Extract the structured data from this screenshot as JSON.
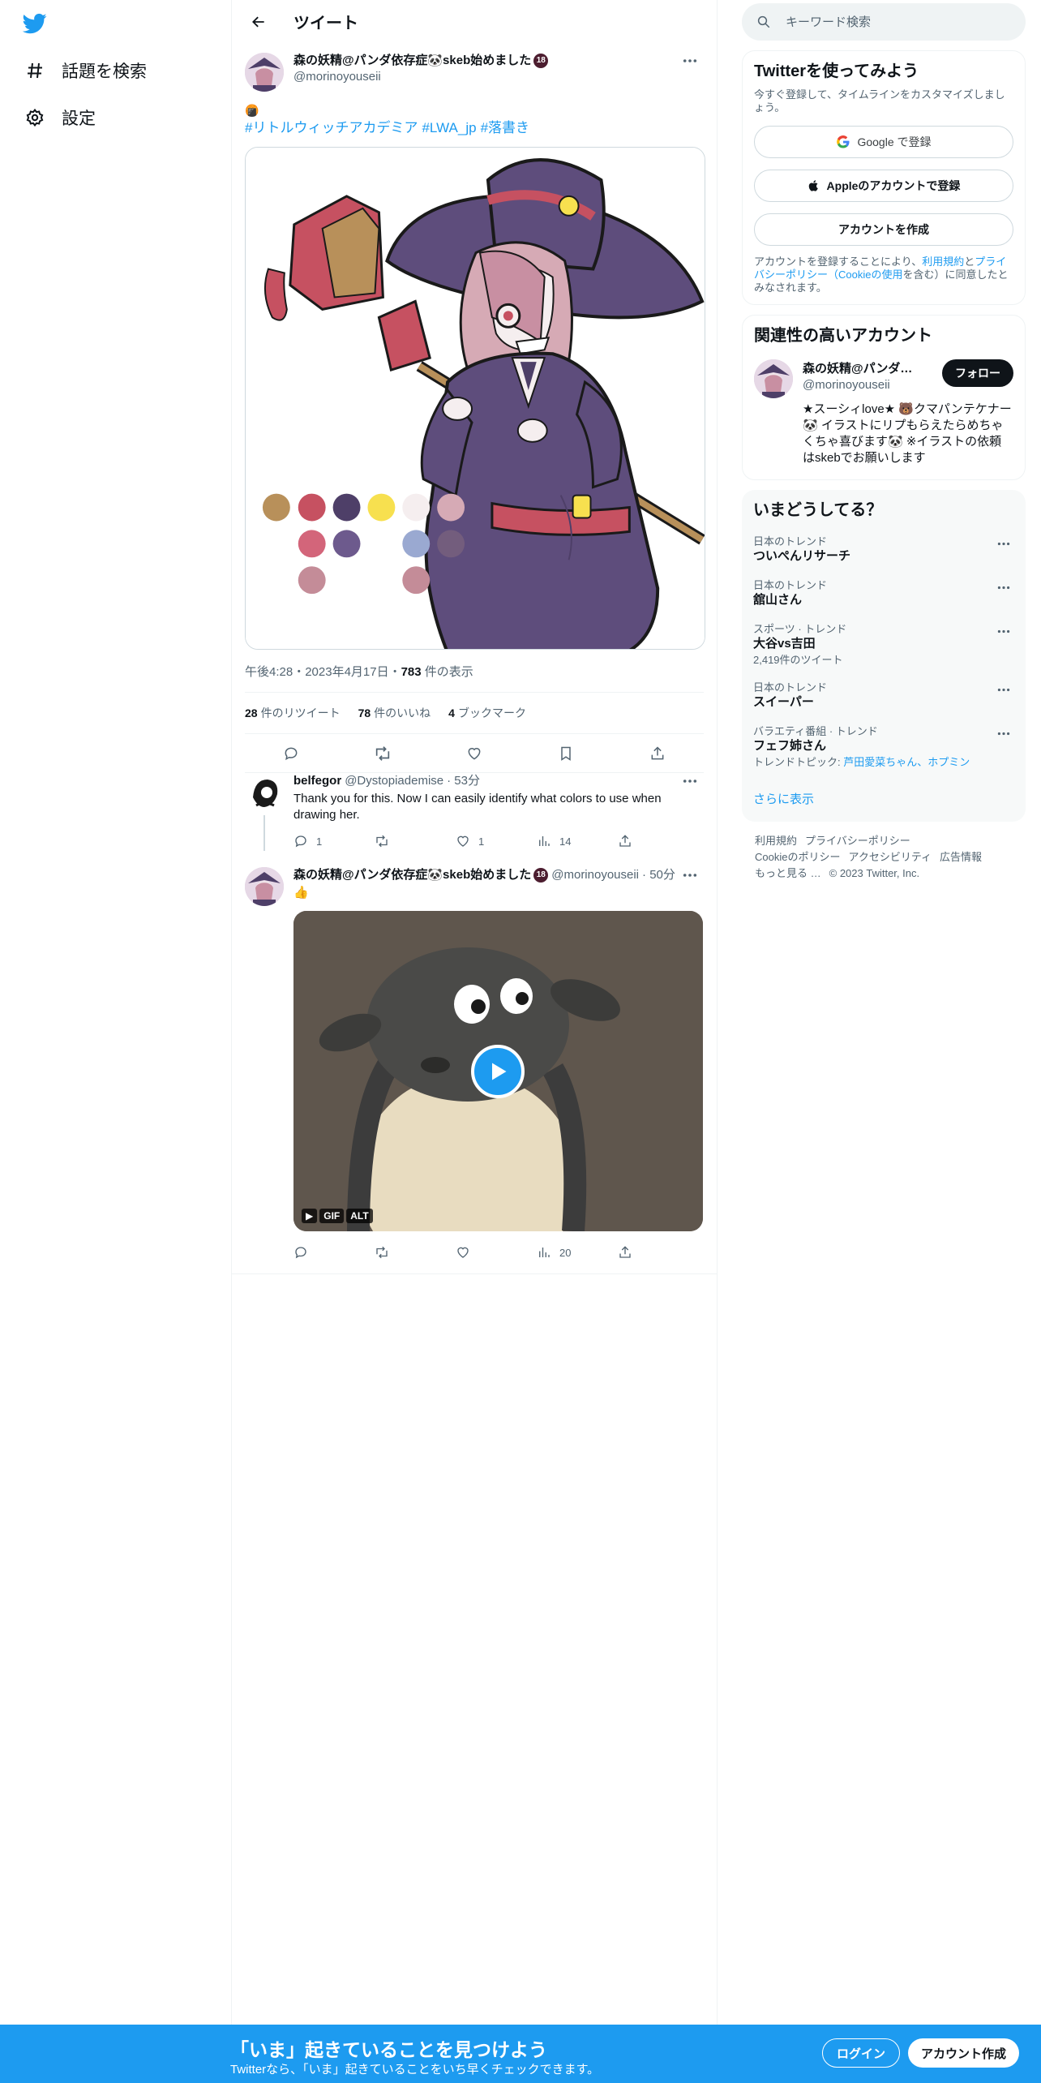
{
  "nav": {
    "explore_label": "話題を検索",
    "settings_label": "設定"
  },
  "header": {
    "title": "ツイート"
  },
  "tweet": {
    "author_name": "森の妖精@パンダ依存症🐼skeb始めました",
    "age_badge": "18",
    "handle": "@morinoyouseii",
    "emoji": "🍘",
    "hashtags": [
      "#リトルウィッチアカデミア",
      "#LWA_jp",
      "#落書き"
    ],
    "meta": "午後4:28・2023年4月17日・",
    "views_count": "783",
    "views_label": " 件の表示",
    "retweets_count": "28",
    "retweets_label": "件のリツイート",
    "likes_count": "78",
    "likes_label": "件のいいね",
    "bookmarks_count": "4",
    "bookmarks_label": "ブックマーク",
    "palette_colors": [
      "#b8905a",
      "#c65161",
      "#4e3f68",
      "#f7e04f",
      "#f5eeef",
      "#d6aab5",
      "#d3657a",
      "#6d5a8d",
      "#9aa9d1",
      "#735d7d",
      "#c48c98",
      "#c48c98"
    ]
  },
  "replies": [
    {
      "name": "belfegor",
      "handle": "@Dystopiademise",
      "time": "· 53分",
      "text": "Thank you for this. Now I can easily identify what colors to use when drawing her.",
      "reply_count": "1",
      "like_count": "1",
      "view_count": "14"
    },
    {
      "name": "森の妖精@パンダ依存症🐼skeb始めました",
      "age_badge": "18",
      "handle": "@morinoyouseii",
      "time": "· 50分",
      "text": "👍",
      "view_count": "20",
      "gif_tags": [
        "▶",
        "GIF",
        "ALT"
      ]
    }
  ],
  "search": {
    "placeholder": "キーワード検索"
  },
  "signup": {
    "title": "Twitterを使ってみよう",
    "subtitle": "今すぐ登録して、タイムラインをカスタマイズしましょう。",
    "google_label": "Google で登録",
    "apple_label": "Appleのアカウントで登録",
    "create_label": "アカウントを作成",
    "legal_pre": "アカウントを登録することにより、",
    "legal_terms": "利用規約",
    "legal_and": "と",
    "legal_privacy": "プライバシーポリシー（Cookieの使用",
    "legal_post": "を含む）に同意したとみなされます。"
  },
  "related": {
    "title": "関連性の高いアカウント",
    "name": "森の妖精@パンダ依存症🐼skeb始めました",
    "handle": "@morinoyouseii",
    "follow_label": "フォロー",
    "bio": "★スーシィlove★ 🐻クマパンテケナー🐼 イラストにリプもらえたらめちゃくちゃ喜びます🐼 ※イラストの依頼はskebでお願いします"
  },
  "trends": {
    "title": "いまどうしてる？",
    "items": [
      {
        "category": "日本のトレンド",
        "name": "ついぺんリサーチ",
        "extra": ""
      },
      {
        "category": "日本のトレンド",
        "name": "舘山さん",
        "extra": ""
      },
      {
        "category": "スポーツ · トレンド",
        "name": "大谷vs吉田",
        "extra": "2,419件のツイート"
      },
      {
        "category": "日本のトレンド",
        "name": "スイーパー",
        "extra": ""
      },
      {
        "category": "バラエティ番組 · トレンド",
        "name": "フェフ姉さん",
        "extra": ""
      }
    ],
    "trend5_topic_label": "トレンドトピック: ",
    "trend5_topic_links": "芦田愛菜ちゃん、ホプミン",
    "show_more": "さらに表示"
  },
  "footer": {
    "links": [
      "利用規約",
      "プライバシーポリシー",
      "Cookieのポリシー",
      "アクセシビリティ",
      "広告情報",
      "もっと見る …"
    ],
    "copyright": "© 2023 Twitter, Inc."
  },
  "banner": {
    "title": "「いま」起きていることを見つけよう",
    "subtitle": "Twitterなら、「いま」起きていることをいち早くチェックできます。",
    "login_label": "ログイン",
    "signup_label": "アカウント作成"
  },
  "colors": {
    "accent": "#1d9bf0",
    "text": "#0f1419",
    "muted": "#536471"
  }
}
